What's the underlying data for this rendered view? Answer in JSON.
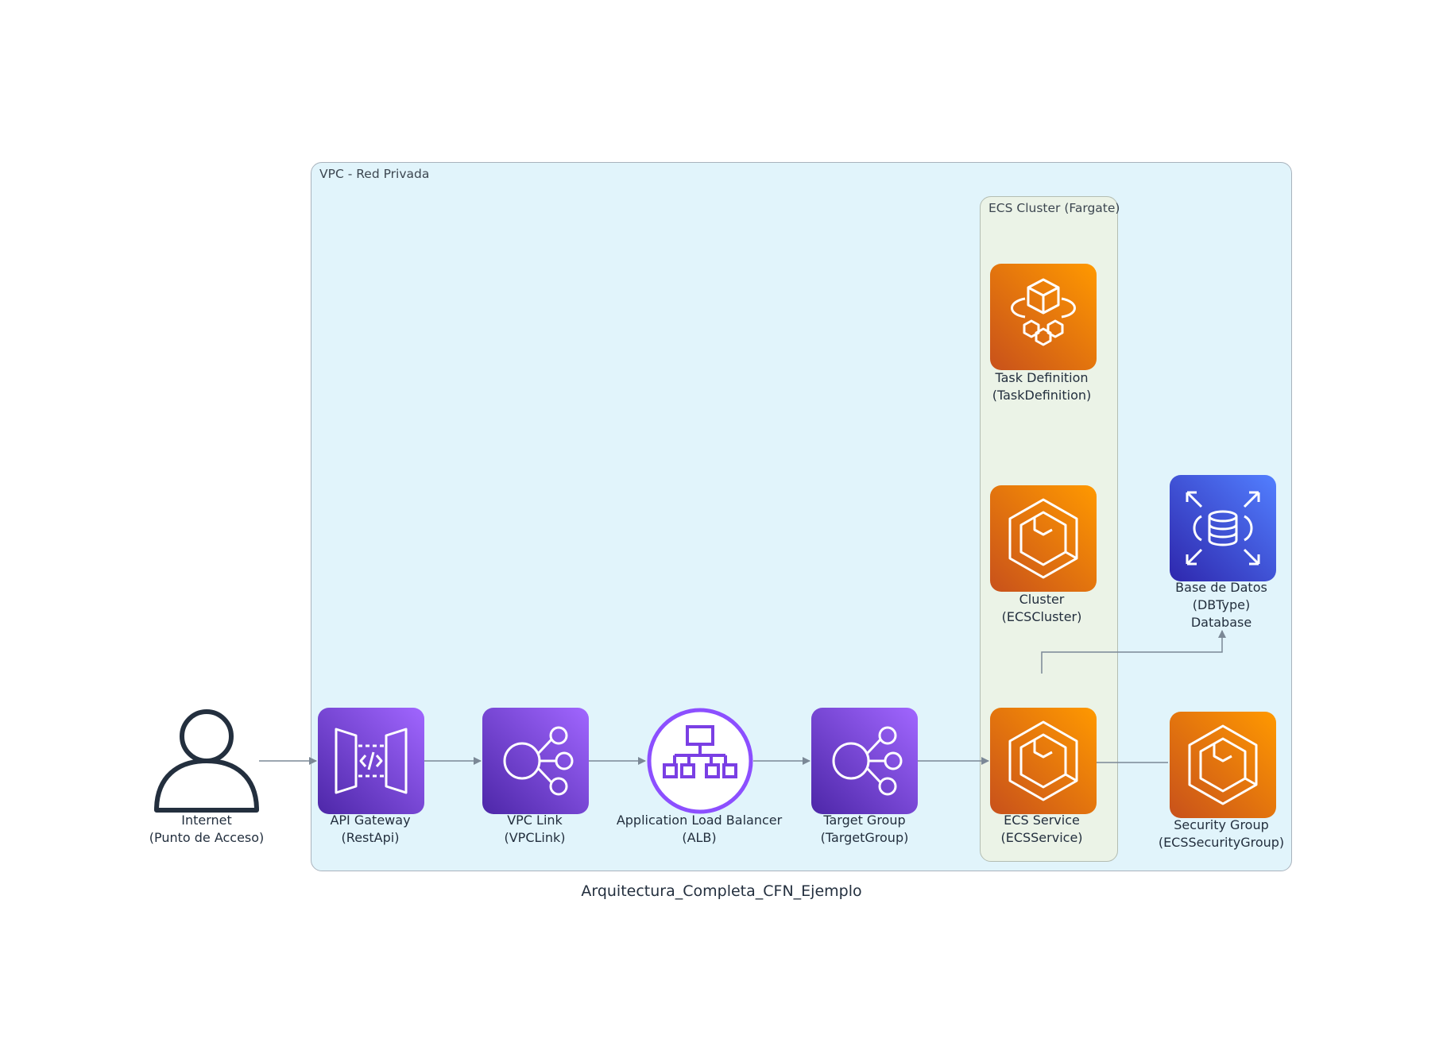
{
  "diagram": {
    "title": "Arquitectura_Completa_CFN_Ejemplo",
    "clusters": {
      "vpc": {
        "label": "VPC - Red Privada",
        "color": "#e1f4fb"
      },
      "ecs": {
        "label": "ECS Cluster (Fargate)",
        "color": "#ebf3e7"
      }
    },
    "nodes": {
      "internet": {
        "name": "Internet",
        "sub": "(Punto de Acceso)",
        "icon": "user-icon"
      },
      "api_gateway": {
        "name": "API Gateway",
        "sub": "(RestApi)",
        "icon": "api-gateway-icon",
        "color": "#8c4fff"
      },
      "vpc_link": {
        "name": "VPC Link",
        "sub": "(VPCLink)",
        "icon": "vpc-link-icon",
        "color": "#8c4fff"
      },
      "alb": {
        "name": "Application Load Balancer",
        "sub": "(ALB)",
        "icon": "load-balancer-icon",
        "color": "#8c4fff"
      },
      "target_group": {
        "name": "Target Group",
        "sub": "(TargetGroup)",
        "icon": "target-group-icon",
        "color": "#8c4fff"
      },
      "ecs_service": {
        "name": "ECS Service",
        "sub": "(ECSService)",
        "icon": "ecs-icon",
        "color": "#ed7100"
      },
      "cluster": {
        "name": "Cluster",
        "sub": "(ECSCluster)",
        "icon": "ecs-icon",
        "color": "#ed7100"
      },
      "task_definition": {
        "name": "Task Definition",
        "sub": "(TaskDefinition)",
        "icon": "fargate-icon",
        "color": "#ed7100"
      },
      "database": {
        "name": "Base de Datos",
        "sub": "(DBType)",
        "sub2": "Database",
        "icon": "rds-icon",
        "color": "#527fff"
      },
      "security_group": {
        "name": "Security Group",
        "sub": "(ECSSecurityGroup)",
        "icon": "ecs-icon",
        "color": "#ed7100"
      }
    },
    "edges": [
      {
        "from": "Internet",
        "to": "API Gateway"
      },
      {
        "from": "API Gateway",
        "to": "VPC Link"
      },
      {
        "from": "VPC Link",
        "to": "Application Load Balancer"
      },
      {
        "from": "Application Load Balancer",
        "to": "Target Group"
      },
      {
        "from": "Target Group",
        "to": "ECS Service"
      },
      {
        "from": "ECS Service",
        "to": "Base de Datos"
      },
      {
        "from": "ECS Service",
        "to": "Security Group"
      }
    ]
  }
}
